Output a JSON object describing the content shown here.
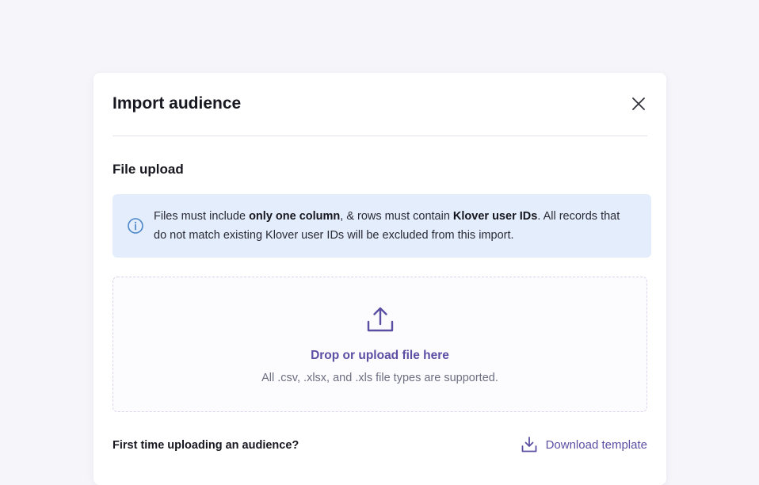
{
  "modal": {
    "title": "Import audience",
    "close_icon": "close-icon"
  },
  "section": {
    "title": "File upload"
  },
  "info": {
    "icon": "info-icon",
    "text_part1": "Files must include ",
    "bold1": "only one column",
    "text_part2": ", & rows must contain ",
    "bold2": "Klover user IDs",
    "text_part3": ". All records that do not match existing Klover user IDs will be excluded from this import."
  },
  "dropzone": {
    "icon": "upload-icon",
    "label": "Drop or upload file here",
    "subtext": "All .csv, .xlsx, and .xls file types are supported."
  },
  "footer": {
    "question": "First time uploading an audience?",
    "download_icon": "download-icon",
    "download_label": "Download template"
  },
  "colors": {
    "accent": "#5b4fa3",
    "info_bg": "#e3edfb",
    "info_icon": "#4a86c8"
  }
}
